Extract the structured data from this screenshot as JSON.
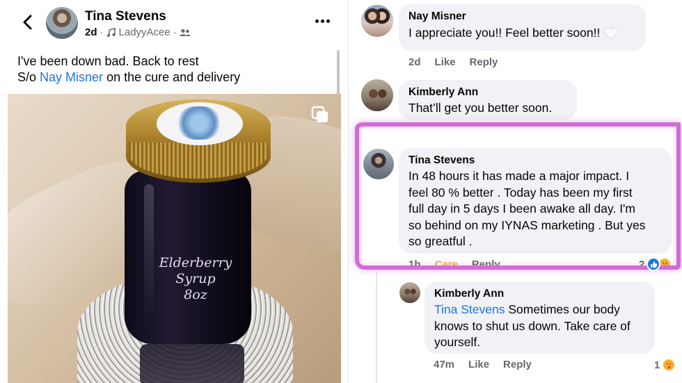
{
  "post": {
    "author": "Tina Stevens",
    "age": "2d",
    "audio": "LadyyAcee",
    "text_line1": "I've been down bad. Back to rest",
    "text_line2_prefix": "S/o ",
    "text_line2_mention": "Nay Misner",
    "text_line2_suffix": " on the cure and delivery",
    "image_text": [
      "Elderberry",
      "Syrup",
      "8oz"
    ]
  },
  "comments": [
    {
      "author": "Nay Misner",
      "text": "I appreciate you!! Feel better soon!!",
      "age": "2d",
      "like_label": "Like",
      "reply_label": "Reply"
    },
    {
      "author": "Kimberly Ann",
      "text": "That’ll get you better soon."
    },
    {
      "author": "Tina Stevens",
      "text_lines": [
        "In 48 hours it has made a major impact. I",
        "feel 80 % better . Today has been my first",
        "full day in 5 days I been awake all day. I'm",
        "so behind on my IYNAS marketing . But yes",
        "so greatful ."
      ],
      "age": "1h",
      "care_label": "Care",
      "reply_label": "Reply",
      "reaction_count": "2"
    },
    {
      "author": "Kimberly Ann",
      "mention": "Tina Stevens",
      "text_lines": [
        " Sometimes our body",
        "knows to shut us down. Take care of",
        "yourself."
      ],
      "age": "47m",
      "like_label": "Like",
      "reply_label": "Reply",
      "reaction_count": "1"
    }
  ],
  "colors": {
    "link": "#1b74e4",
    "highlight": "#d36bd6",
    "care": "#f7b125",
    "bubble": "#f0f2f5"
  }
}
